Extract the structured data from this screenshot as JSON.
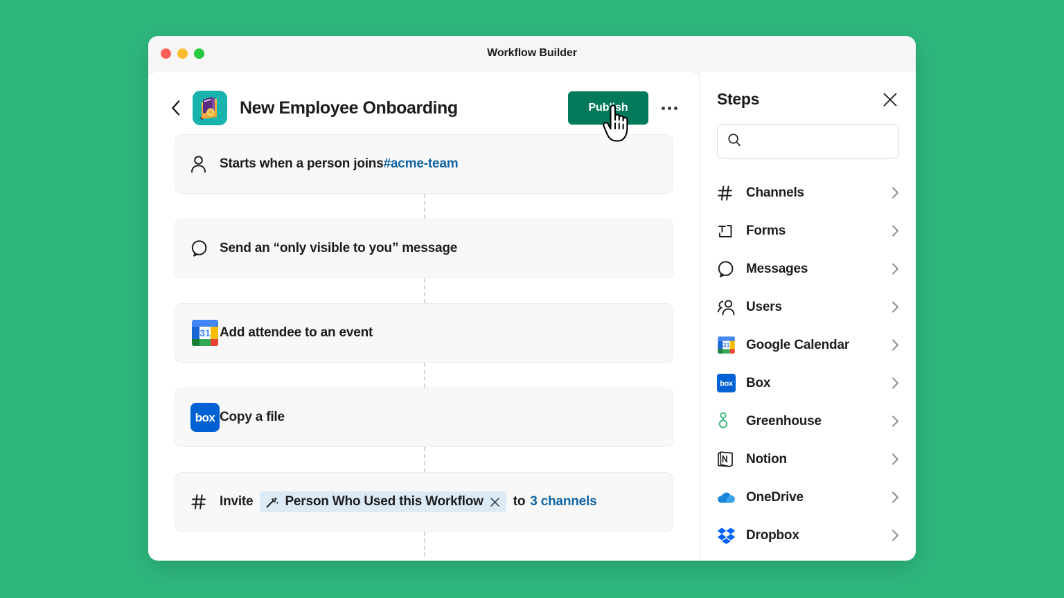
{
  "window": {
    "title": "Workflow Builder",
    "traffic_lights": [
      "close",
      "minimize",
      "maximize"
    ]
  },
  "header": {
    "back_icon": "chevron-left-icon",
    "workflow_icon": "workflow-notebook-icon",
    "workflow_title": "New Employee Onboarding",
    "publish_label": "Publish",
    "more_label": "•••",
    "publish_color": "#007a5a"
  },
  "cursor": {
    "type": "pointing-hand"
  },
  "steps": [
    {
      "icon": "person-icon",
      "text_before": "Starts when a person joins ",
      "link": "#acme-team",
      "text_after": ""
    },
    {
      "icon": "message-bubble-icon",
      "text_before": "Send an “only visible to you” message",
      "link": "",
      "text_after": ""
    },
    {
      "icon": "google-calendar-icon",
      "text_before": "Add attendee to an event",
      "link": "",
      "text_after": ""
    },
    {
      "icon": "box-icon",
      "text_before": "Copy a file",
      "link": "",
      "text_after": ""
    },
    {
      "icon": "hash-icon",
      "text_before": "Invite",
      "chip": {
        "icon": "magic-wand-icon",
        "label": "Person Who Used this Workflow",
        "remove_icon": "close-icon",
        "bg": "#dceaf5"
      },
      "text_mid": "to ",
      "link": "3 channels",
      "text_after": ""
    }
  ],
  "sidebar": {
    "title": "Steps",
    "close_icon": "close-icon",
    "search": {
      "icon": "search-icon",
      "value": "",
      "placeholder": ""
    },
    "items": [
      {
        "label": "Channels",
        "icon": "hash-icon",
        "arrow": "chevron-right-icon"
      },
      {
        "label": "Forms",
        "icon": "form-text-icon",
        "arrow": "chevron-right-icon"
      },
      {
        "label": "Messages",
        "icon": "message-bubble-icon",
        "arrow": "chevron-right-icon"
      },
      {
        "label": "Users",
        "icon": "users-icon",
        "arrow": "chevron-right-icon"
      },
      {
        "label": "Google Calendar",
        "icon": "google-calendar-icon",
        "arrow": "chevron-right-icon"
      },
      {
        "label": "Box",
        "icon": "box-icon",
        "arrow": "chevron-right-icon"
      },
      {
        "label": "Greenhouse",
        "icon": "greenhouse-icon",
        "arrow": "chevron-right-icon"
      },
      {
        "label": "Notion",
        "icon": "notion-icon",
        "arrow": "chevron-right-icon"
      },
      {
        "label": "OneDrive",
        "icon": "onedrive-icon",
        "arrow": "chevron-right-icon"
      },
      {
        "label": "Dropbox",
        "icon": "dropbox-icon",
        "arrow": "chevron-right-icon"
      }
    ]
  },
  "colors": {
    "page_background": "#2eb67d",
    "publish_green": "#007a5a",
    "link_blue": "#1264a3",
    "card_background": "#f8f8f8",
    "workflow_icon_teal": "#18b3ad"
  }
}
